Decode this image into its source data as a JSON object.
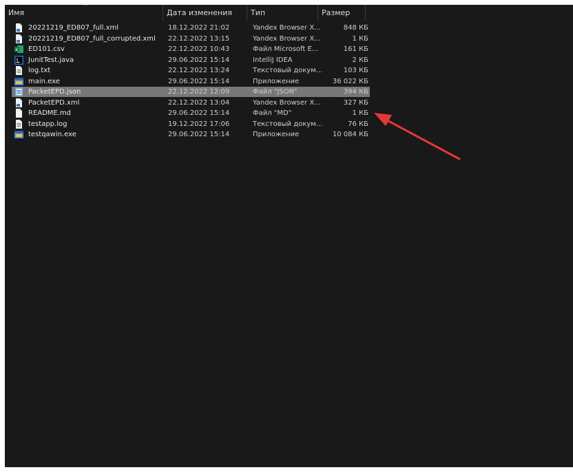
{
  "columns": {
    "name": "Имя",
    "date": "Дата изменения",
    "type": "Тип",
    "size": "Размер"
  },
  "sort_indicator": "^",
  "files": [
    {
      "name": "20221219_ED807_full.xml",
      "date": "18.12.2022 21:02",
      "type": "Yandex Browser X...",
      "size": "848 КБ",
      "icon": "xml-file-icon"
    },
    {
      "name": "20221219_ED807_full_corrupted.xml",
      "date": "22.12.2022 13:15",
      "type": "Yandex Browser X...",
      "size": "1 КБ",
      "icon": "xml-file-icon"
    },
    {
      "name": "ED101.csv",
      "date": "22.12.2022 10:43",
      "type": "Файл Microsoft E...",
      "size": "161 КБ",
      "icon": "excel-file-icon"
    },
    {
      "name": "JunitTest.java",
      "date": "29.06.2022 15:14",
      "type": "IntelliJ IDEA",
      "size": "2 КБ",
      "icon": "intellij-file-icon"
    },
    {
      "name": "log.txt",
      "date": "22.12.2022 13:24",
      "type": "Текстовый докум...",
      "size": "103 КБ",
      "icon": "text-file-icon"
    },
    {
      "name": "main.exe",
      "date": "29.06.2022 15:14",
      "type": "Приложение",
      "size": "36 022 КБ",
      "icon": "exe-file-icon"
    },
    {
      "name": "PacketEPD.json",
      "date": "22.12.2022 12:09",
      "type": "Файл \"JSON\"",
      "size": "394 КБ",
      "icon": "json-file-icon",
      "selected": true
    },
    {
      "name": "PacketEPD.xml",
      "date": "22.12.2022 13:04",
      "type": "Yandex Browser X...",
      "size": "327 КБ",
      "icon": "xml-file-icon"
    },
    {
      "name": "README.md",
      "date": "29.06.2022 15:14",
      "type": "Файл \"MD\"",
      "size": "1 КБ",
      "icon": "blank-file-icon"
    },
    {
      "name": "testapp.log",
      "date": "19.12.2022 17:06",
      "type": "Текстовый докум...",
      "size": "76 КБ",
      "icon": "text-file-icon"
    },
    {
      "name": "testqawin.exe",
      "date": "29.06.2022 15:14",
      "type": "Приложение",
      "size": "10 084 КБ",
      "icon": "exe-file-icon"
    }
  ],
  "annotation": {
    "color": "#e53935"
  }
}
